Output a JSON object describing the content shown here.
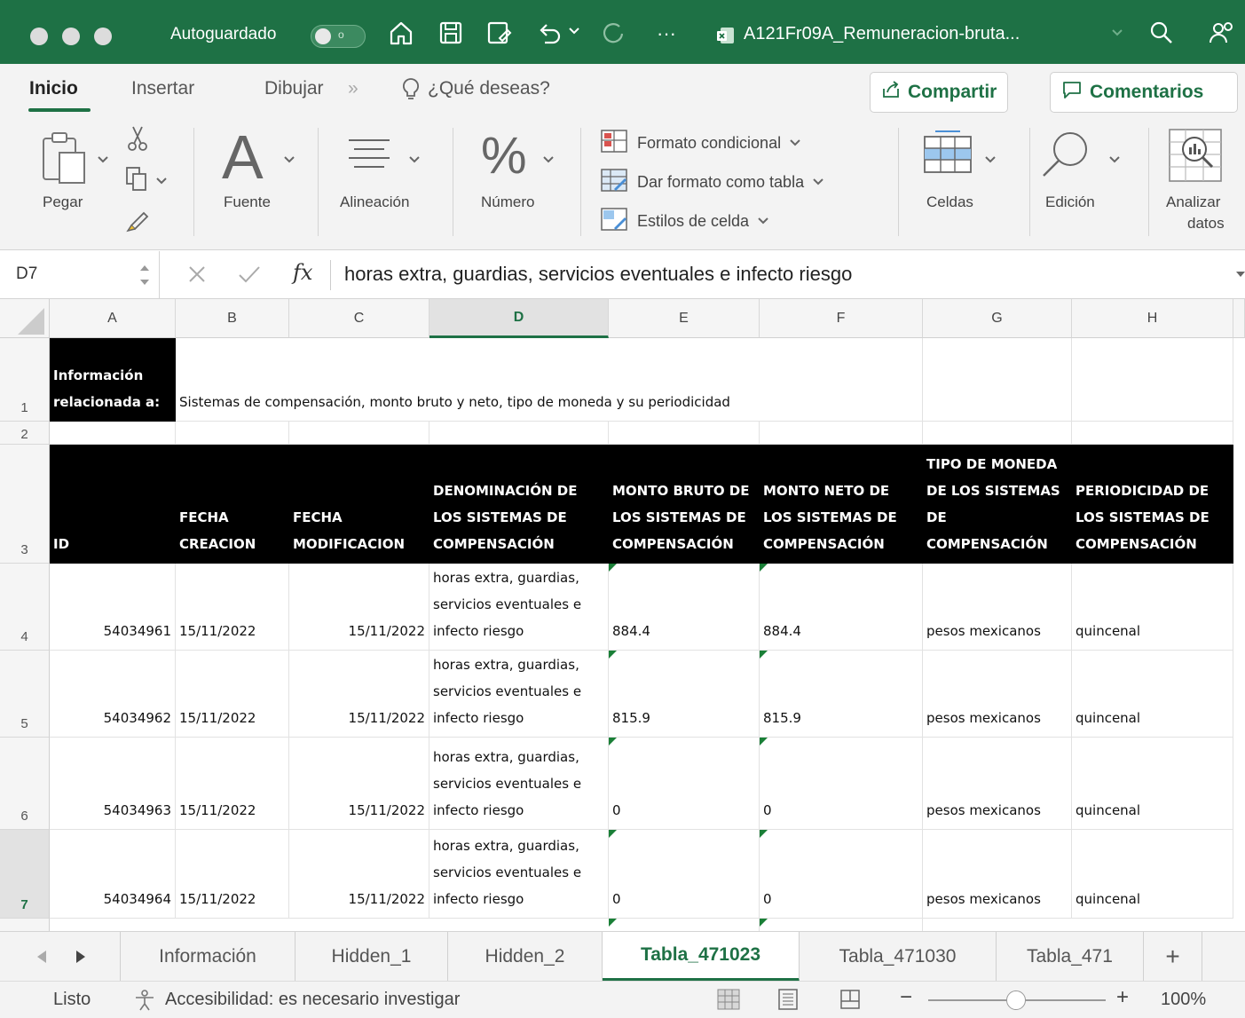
{
  "titlebar": {
    "autosave_label": "Autoguardado",
    "autosave_state": "o",
    "document_title": "A121Fr09A_Remuneracion-bruta...",
    "more": "···"
  },
  "ribbon_tabs": [
    "Inicio",
    "Insertar",
    "Dibujar"
  ],
  "ribbon_more": "»",
  "tell_me": "¿Qué deseas?",
  "share_label": "Compartir",
  "comments_label": "Comentarios",
  "ribbon": {
    "paste": "Pegar",
    "font": "Fuente",
    "alignment": "Alineación",
    "number": "Número",
    "conditional_format": "Formato condicional",
    "format_as_table": "Dar formato como tabla",
    "cell_styles": "Estilos de celda",
    "cells": "Celdas",
    "editing": "Edición",
    "analyze_1": "Analizar",
    "analyze_2": "datos"
  },
  "formula_bar": {
    "name_box": "D7",
    "fx": "fx",
    "content": "horas extra, guardias, servicios eventuales e infecto riesgo"
  },
  "columns": [
    "A",
    "B",
    "C",
    "D",
    "E",
    "F",
    "G",
    "H"
  ],
  "rows": [
    "1",
    "2",
    "3",
    "4",
    "5",
    "6",
    "7"
  ],
  "sheet": {
    "a1": "Información relacionada a:",
    "b1": "Sistemas de compensación, monto bruto y neto, tipo de moneda y su periodicidad",
    "headers": [
      "ID",
      "FECHA CREACION",
      "FECHA MODIFICACION",
      "DENOMINACIÓN DE LOS SISTEMAS DE COMPENSACIÓN",
      "MONTO BRUTO DE LOS SISTEMAS DE COMPENSACIÓN",
      "MONTO NETO DE LOS SISTEMAS DE COMPENSACIÓN",
      "TIPO DE MONEDA DE LOS SISTEMAS DE COMPENSACIÓN",
      "PERIODICIDAD DE LOS SISTEMAS DE COMPENSACIÓN"
    ],
    "data": [
      [
        "54034961",
        "15/11/2022",
        "15/11/2022",
        "horas extra, guardias, servicios eventuales e infecto riesgo",
        "884.4",
        "884.4",
        "pesos mexicanos",
        "quincenal"
      ],
      [
        "54034962",
        "15/11/2022",
        "15/11/2022",
        "horas extra, guardias, servicios eventuales e infecto riesgo",
        "815.9",
        "815.9",
        "pesos mexicanos",
        "quincenal"
      ],
      [
        "54034963",
        "15/11/2022",
        "15/11/2022",
        "horas extra, guardias, servicios eventuales e infecto riesgo",
        "0",
        "0",
        "pesos mexicanos",
        "quincenal"
      ],
      [
        "54034964",
        "15/11/2022",
        "15/11/2022",
        "horas extra, guardias, servicios eventuales e infecto riesgo",
        "0",
        "0",
        "pesos mexicanos",
        "quincenal"
      ]
    ]
  },
  "sheet_tabs": [
    "Información",
    "Hidden_1",
    "Hidden_2",
    "Tabla_471023",
    "Tabla_471030",
    "Tabla_471"
  ],
  "add_sheet": "+",
  "status": {
    "ready": "Listo",
    "accessibility": "Accesibilidad: es necesario investigar",
    "zoom": "100%",
    "zoom_minus": "−",
    "zoom_plus": "+"
  },
  "colors": {
    "accent": "#1e7145",
    "header_bg": "#000000",
    "triangle": "#1a7f37"
  },
  "icons": [
    "home-icon",
    "save-icon",
    "save-as-icon",
    "undo-icon",
    "redo-icon",
    "search-icon",
    "share-people-icon",
    "share-icon",
    "comment-icon",
    "paste-icon",
    "cut-icon",
    "copy-icon",
    "format-painter-icon",
    "font-icon",
    "align-icon",
    "percent-icon",
    "conditional-format-icon",
    "table-format-icon",
    "cell-styles-icon",
    "cells-icon",
    "editing-search-icon",
    "analyze-data-icon",
    "lightbulb-icon",
    "cancel-icon",
    "confirm-icon"
  ]
}
